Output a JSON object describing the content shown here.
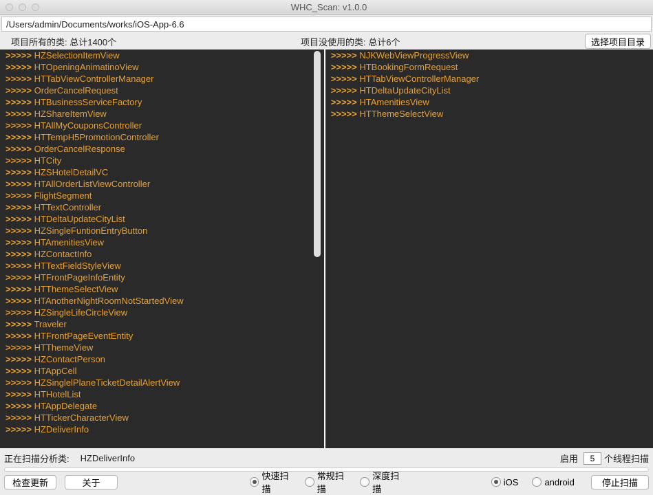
{
  "window": {
    "title": "WHC_Scan: v1.0.0"
  },
  "path": "/Users/admin/Documents/works/iOS-App-6.6",
  "columns": {
    "all": "项目所有的类: 总计1400个",
    "unused": "项目没使用的类: 总计6个",
    "select_dir": "选择项目目录"
  },
  "prefix": ">>>>>",
  "left_classes": [
    "HZSelectionItemView",
    "HTOpeningAnimatinoView",
    "HTTabViewControllerManager",
    "OrderCancelRequest",
    "HTBusinessServiceFactory",
    "HZShareItemView",
    "HTAllMyCouponsController",
    "HTTempH5PromotionController",
    "OrderCancelResponse",
    "HTCity",
    "HZSHotelDetailVC",
    "HTAllOrderListViewController",
    "FlightSegment",
    "HTTextController",
    "HTDeltaUpdateCityList",
    "HZSingleFuntionEntryButton",
    "HTAmenitiesView",
    "HZContactInfo",
    "HTTextFieldStyleView",
    "HTFrontPageInfoEntity",
    "HTThemeSelectView",
    "HTAnotherNightRoomNotStartedView",
    "HZSingleLifeCircleView",
    "Traveler",
    "HTFrontPageEventEntity",
    "HTThemeView",
    "HZContactPerson",
    "HTAppCell",
    "HZSinglelPlaneTicketDetailAlertView",
    "HTHotelList",
    "HTAppDelegate",
    "HTTickerCharacterView",
    "HZDeliverInfo"
  ],
  "right_classes": [
    "NJKWebViewProgressView",
    "HTBookingFormRequest",
    "HTTabViewControllerManager",
    "HTDeltaUpdateCityList",
    "HTAmenitiesView",
    "HTThemeSelectView"
  ],
  "status": {
    "label": "正在扫描分析类:",
    "value": "HZDeliverInfo"
  },
  "threads": {
    "prefix": "启用",
    "count": "5",
    "suffix": "个线程扫描"
  },
  "buttons": {
    "check_update": "检查更新",
    "about": "关于",
    "stop": "停止扫描"
  },
  "scanmode": {
    "fast": "快速扫描",
    "normal": "常规扫描",
    "deep": "深度扫描",
    "selected": "fast"
  },
  "platform": {
    "ios": "iOS",
    "android": "android",
    "selected": "ios"
  }
}
